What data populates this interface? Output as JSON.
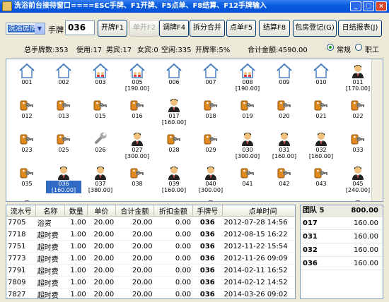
{
  "window": {
    "title": "洗浴前台接待窗口====ESC手牌、F1开牌、F5点单、F8结算、F12手牌输入",
    "controls": {
      "minimize": "_",
      "maximize": "□",
      "close": "×"
    }
  },
  "toolbar": {
    "dept_selected": "洗浴房牌",
    "card_label": "手牌",
    "card_value": "036",
    "buttons": {
      "open": "开牌F1",
      "single": "单开F2",
      "swap": "调牌F4",
      "split": "拆分合并",
      "order": "点单F5",
      "checkout": "结算F8",
      "room_register": "包房登记(G)",
      "daily_report": "日结报表(J)"
    }
  },
  "stats": {
    "total": "总手牌数:353",
    "used": "使用:17",
    "male": "男宾:17",
    "female": "女宾:0",
    "free": "空闲:335",
    "rate": "开牌率:5%",
    "amount": "合计金额:4590.00",
    "mode_normal": "常规",
    "mode_staff": "职工"
  },
  "tiles": [
    {
      "num": "001",
      "amt": "",
      "icon": "house-icon"
    },
    {
      "num": "002",
      "amt": "",
      "icon": "house-icon"
    },
    {
      "num": "003",
      "amt": "",
      "icon": "house-occupied-icon"
    },
    {
      "num": "005",
      "amt": "[190.00]",
      "icon": "house-occupied-icon"
    },
    {
      "num": "006",
      "amt": "",
      "icon": "house-icon"
    },
    {
      "num": "007",
      "amt": "",
      "icon": "house-icon"
    },
    {
      "num": "008",
      "amt": "[190.00]",
      "icon": "house-occupied-icon"
    },
    {
      "num": "009",
      "amt": "",
      "icon": "house-icon"
    },
    {
      "num": "010",
      "amt": "",
      "icon": "house-icon"
    },
    {
      "num": "011",
      "amt": "[170.00]",
      "icon": "person-icon"
    },
    {
      "num": "012",
      "amt": "",
      "icon": "key-tag-icon"
    },
    {
      "num": "013",
      "amt": "",
      "icon": "key-tag-icon"
    },
    {
      "num": "015",
      "amt": "",
      "icon": "key-tag-icon"
    },
    {
      "num": "016",
      "amt": "",
      "icon": "key-tag-icon"
    },
    {
      "num": "017",
      "amt": "[160.00]",
      "icon": "person-icon"
    },
    {
      "num": "018",
      "amt": "",
      "icon": "key-tag-icon"
    },
    {
      "num": "019",
      "amt": "",
      "icon": "key-tag-icon"
    },
    {
      "num": "020",
      "amt": "",
      "icon": "key-tag-icon"
    },
    {
      "num": "021",
      "amt": "",
      "icon": "key-tag-icon"
    },
    {
      "num": "022",
      "amt": "",
      "icon": "key-tag-icon"
    },
    {
      "num": "023",
      "amt": "",
      "icon": "key-tag-icon"
    },
    {
      "num": "025",
      "amt": "",
      "icon": "key-tag-icon"
    },
    {
      "num": "026",
      "amt": "",
      "icon": "wrench-icon"
    },
    {
      "num": "027",
      "amt": "[300.00]",
      "icon": "person-icon"
    },
    {
      "num": "028",
      "amt": "",
      "icon": "key-tag-icon"
    },
    {
      "num": "029",
      "amt": "",
      "icon": "key-tag-icon"
    },
    {
      "num": "030",
      "amt": "[300.00]",
      "icon": "person-icon"
    },
    {
      "num": "031",
      "amt": "[160.00]",
      "icon": "person-icon"
    },
    {
      "num": "032",
      "amt": "[160.00]",
      "icon": "person-icon"
    },
    {
      "num": "033",
      "amt": "",
      "icon": "key-tag-icon"
    },
    {
      "num": "035",
      "amt": "",
      "icon": "key-tag-icon"
    },
    {
      "num": "036",
      "amt": "[160.00]",
      "icon": "person-icon",
      "selected": true
    },
    {
      "num": "037",
      "amt": "[380.00]",
      "icon": "person-icon"
    },
    {
      "num": "038",
      "amt": "",
      "icon": "key-tag-icon"
    },
    {
      "num": "039",
      "amt": "[160.00]",
      "icon": "person-icon"
    },
    {
      "num": "040",
      "amt": "[300.00]",
      "icon": "person-icon"
    },
    {
      "num": "041",
      "amt": "",
      "icon": "key-tag-icon"
    },
    {
      "num": "042",
      "amt": "",
      "icon": "key-tag-icon"
    },
    {
      "num": "043",
      "amt": "",
      "icon": "key-tag-icon"
    },
    {
      "num": "045",
      "amt": "[240.00]",
      "icon": "person-icon"
    },
    {
      "num": "",
      "amt": "",
      "icon": "person-icon"
    },
    {
      "num": "",
      "amt": "",
      "icon": "key-tag-icon"
    },
    {
      "num": "",
      "amt": "",
      "icon": "key-tag-icon"
    },
    {
      "num": "",
      "amt": "",
      "icon": "key-tag-icon"
    },
    {
      "num": "",
      "amt": "",
      "icon": "key-tag-icon"
    },
    {
      "num": "",
      "amt": "",
      "icon": "person-icon"
    },
    {
      "num": "",
      "amt": "",
      "icon": "key-tag-icon"
    },
    {
      "num": "",
      "amt": "",
      "icon": "key-tag-icon"
    },
    {
      "num": "",
      "amt": "",
      "icon": "key-tag-icon"
    },
    {
      "num": "",
      "amt": "",
      "icon": "person-icon"
    }
  ],
  "records": {
    "columns": [
      "流水号",
      "名称",
      "数量",
      "单价",
      "合计金额",
      "折扣金额",
      "手牌号",
      "点单时间"
    ],
    "rows": [
      [
        "7705",
        "浴资",
        "1.00",
        "20.00",
        "20.00",
        "0.00",
        "036",
        "2012-07-28 14:56"
      ],
      [
        "7718",
        "超时费",
        "1.00",
        "20.00",
        "20.00",
        "0.00",
        "036",
        "2012-08-15 16:22"
      ],
      [
        "7751",
        "超时费",
        "1.00",
        "20.00",
        "20.00",
        "0.00",
        "036",
        "2012-11-22 15:54"
      ],
      [
        "7773",
        "超时费",
        "1.00",
        "20.00",
        "20.00",
        "0.00",
        "036",
        "2012-11-26 09:09"
      ],
      [
        "7791",
        "超时费",
        "1.00",
        "20.00",
        "20.00",
        "0.00",
        "036",
        "2014-02-11 16:52"
      ],
      [
        "7809",
        "超时费",
        "1.00",
        "20.00",
        "20.00",
        "0.00",
        "036",
        "2014-02-12 14:52"
      ],
      [
        "7827",
        "超时费",
        "1.00",
        "20.00",
        "20.00",
        "0.00",
        "036",
        "2014-03-26 09:02"
      ]
    ]
  },
  "group": {
    "head_label": "团队 5",
    "head_value": "800.00",
    "rows": [
      {
        "card": "017",
        "amount": "160.00"
      },
      {
        "card": "031",
        "amount": "160.00"
      },
      {
        "card": "032",
        "amount": "160.00"
      },
      {
        "card": "036",
        "amount": "160.00"
      }
    ]
  },
  "colors": {
    "accent": "#316ac5",
    "titlebar": "#0a5ee0",
    "house": "#4a7fc1",
    "key_tag": "#e08a1e",
    "person_hair": "#111111",
    "skin": "#f1c27d"
  }
}
